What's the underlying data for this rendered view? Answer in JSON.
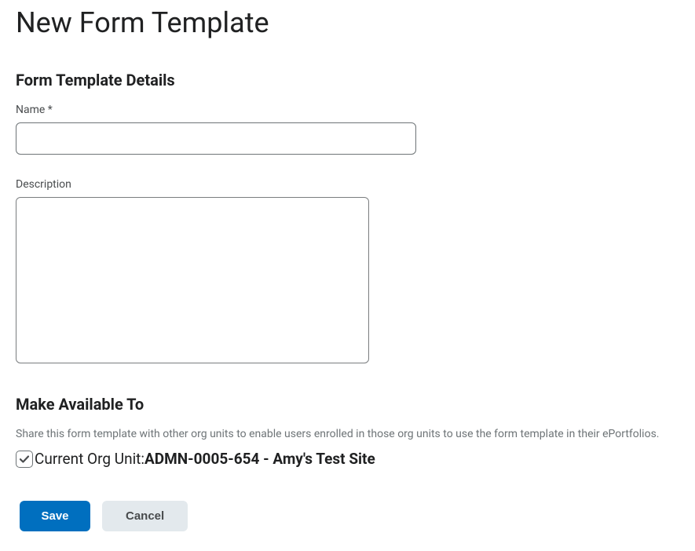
{
  "page": {
    "title": "New Form Template"
  },
  "details": {
    "heading": "Form Template Details",
    "name_label": "Name",
    "name_required": "*",
    "name_value": "",
    "description_label": "Description",
    "description_value": ""
  },
  "availability": {
    "heading": "Make Available To",
    "help_text": "Share this form template with other org units to enable users enrolled in those org units to use the form template in their ePortfolios.",
    "checkbox_checked": true,
    "org_unit_label": "Current Org Unit: ",
    "org_unit_value": "ADMN-0005-654 - Amy's Test Site"
  },
  "actions": {
    "save": "Save",
    "cancel": "Cancel"
  }
}
